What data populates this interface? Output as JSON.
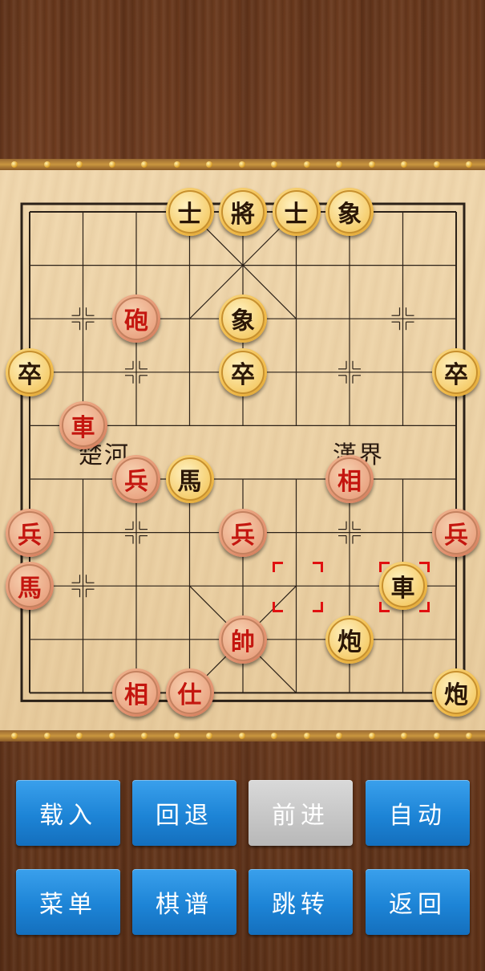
{
  "board": {
    "river_left": "楚河",
    "river_right": "漢界",
    "highlight_color": "#e01010"
  },
  "pieces": [
    {
      "name": "black-advisor-1",
      "side": "black",
      "char": "士",
      "col": 3,
      "row": 0
    },
    {
      "name": "black-general",
      "side": "black",
      "char": "將",
      "col": 4,
      "row": 0
    },
    {
      "name": "black-advisor-2",
      "side": "black",
      "char": "士",
      "col": 5,
      "row": 0
    },
    {
      "name": "black-elephant-1",
      "side": "black",
      "char": "象",
      "col": 6,
      "row": 0
    },
    {
      "name": "red-cannon-1",
      "side": "red",
      "char": "砲",
      "col": 2,
      "row": 2
    },
    {
      "name": "black-elephant-2",
      "side": "black",
      "char": "象",
      "col": 4,
      "row": 2
    },
    {
      "name": "black-soldier-1",
      "side": "black",
      "char": "卒",
      "col": 0,
      "row": 3
    },
    {
      "name": "black-soldier-2",
      "side": "black",
      "char": "卒",
      "col": 4,
      "row": 3
    },
    {
      "name": "black-soldier-3",
      "side": "black",
      "char": "卒",
      "col": 8,
      "row": 3
    },
    {
      "name": "red-chariot",
      "side": "red",
      "char": "車",
      "col": 1,
      "row": 4
    },
    {
      "name": "red-soldier-1",
      "side": "red",
      "char": "兵",
      "col": 2,
      "row": 5
    },
    {
      "name": "black-horse",
      "side": "black",
      "char": "馬",
      "col": 3,
      "row": 5
    },
    {
      "name": "red-elephant-1",
      "side": "red",
      "char": "相",
      "col": 6,
      "row": 5
    },
    {
      "name": "red-soldier-2",
      "side": "red",
      "char": "兵",
      "col": 0,
      "row": 6
    },
    {
      "name": "red-soldier-3",
      "side": "red",
      "char": "兵",
      "col": 4,
      "row": 6
    },
    {
      "name": "red-soldier-4",
      "side": "red",
      "char": "兵",
      "col": 8,
      "row": 6
    },
    {
      "name": "red-horse",
      "side": "red",
      "char": "馬",
      "col": 0,
      "row": 7
    },
    {
      "name": "black-chariot",
      "side": "black",
      "char": "車",
      "col": 7,
      "row": 7
    },
    {
      "name": "red-general",
      "side": "red",
      "char": "帥",
      "col": 4,
      "row": 8
    },
    {
      "name": "black-cannon-1",
      "side": "black",
      "char": "炮",
      "col": 6,
      "row": 8
    },
    {
      "name": "red-elephant-2",
      "side": "red",
      "char": "相",
      "col": 2,
      "row": 9
    },
    {
      "name": "red-advisor",
      "side": "red",
      "char": "仕",
      "col": 3,
      "row": 9
    },
    {
      "name": "black-cannon-2",
      "side": "black",
      "char": "炮",
      "col": 8,
      "row": 9
    }
  ],
  "last_move": {
    "from": {
      "col": 5,
      "row": 7
    },
    "to": {
      "col": 7,
      "row": 7
    }
  },
  "buttons": {
    "load": "载入",
    "undo": "回退",
    "forward": "前进",
    "auto": "自动",
    "menu": "菜单",
    "record": "棋谱",
    "jump": "跳转",
    "back": "返回"
  }
}
